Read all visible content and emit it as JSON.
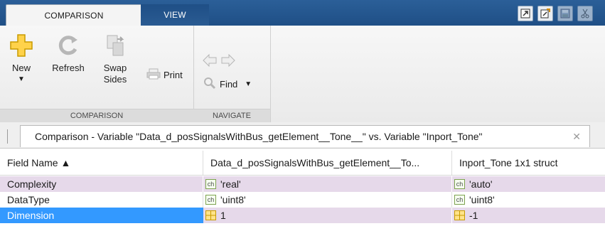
{
  "tabs": {
    "active": "COMPARISON",
    "inactive": "VIEW"
  },
  "quick_access": [
    "restore-window-icon",
    "new-window-icon",
    "save-icon",
    "cut-icon"
  ],
  "ribbon": {
    "comparison_group": {
      "title": "COMPARISON",
      "new_label": "New",
      "refresh_label": "Refresh",
      "swap_label_1": "Swap",
      "swap_label_2": "Sides",
      "print_label": "Print"
    },
    "navigate_group": {
      "title": "NAVIGATE",
      "find_label": "Find"
    }
  },
  "document_tab": {
    "title": "Comparison - Variable \"Data_d_posSignalsWithBus_getElement__Tone__\" vs. Variable \"Inport_Tone\""
  },
  "table": {
    "columns": [
      "Field Name ▲",
      "Data_d_posSignalsWithBus_getElement__To...",
      "Inport_Tone 1x1 struct"
    ],
    "rows": [
      {
        "field": "Complexity",
        "left": "'real'",
        "right": "'auto'",
        "type": "char",
        "state": "diff"
      },
      {
        "field": "DataType",
        "left": "'uint8'",
        "right": "'uint8'",
        "type": "char",
        "state": "same"
      },
      {
        "field": "Dimension",
        "left": "1",
        "right": "-1",
        "type": "numeric",
        "state": "selected-diff"
      }
    ]
  },
  "colors": {
    "header_blue": "#1f4f86",
    "diff_row": "#e6d9ea",
    "selected_row": "#3399ff",
    "grid_line": "#dcdcdc"
  }
}
